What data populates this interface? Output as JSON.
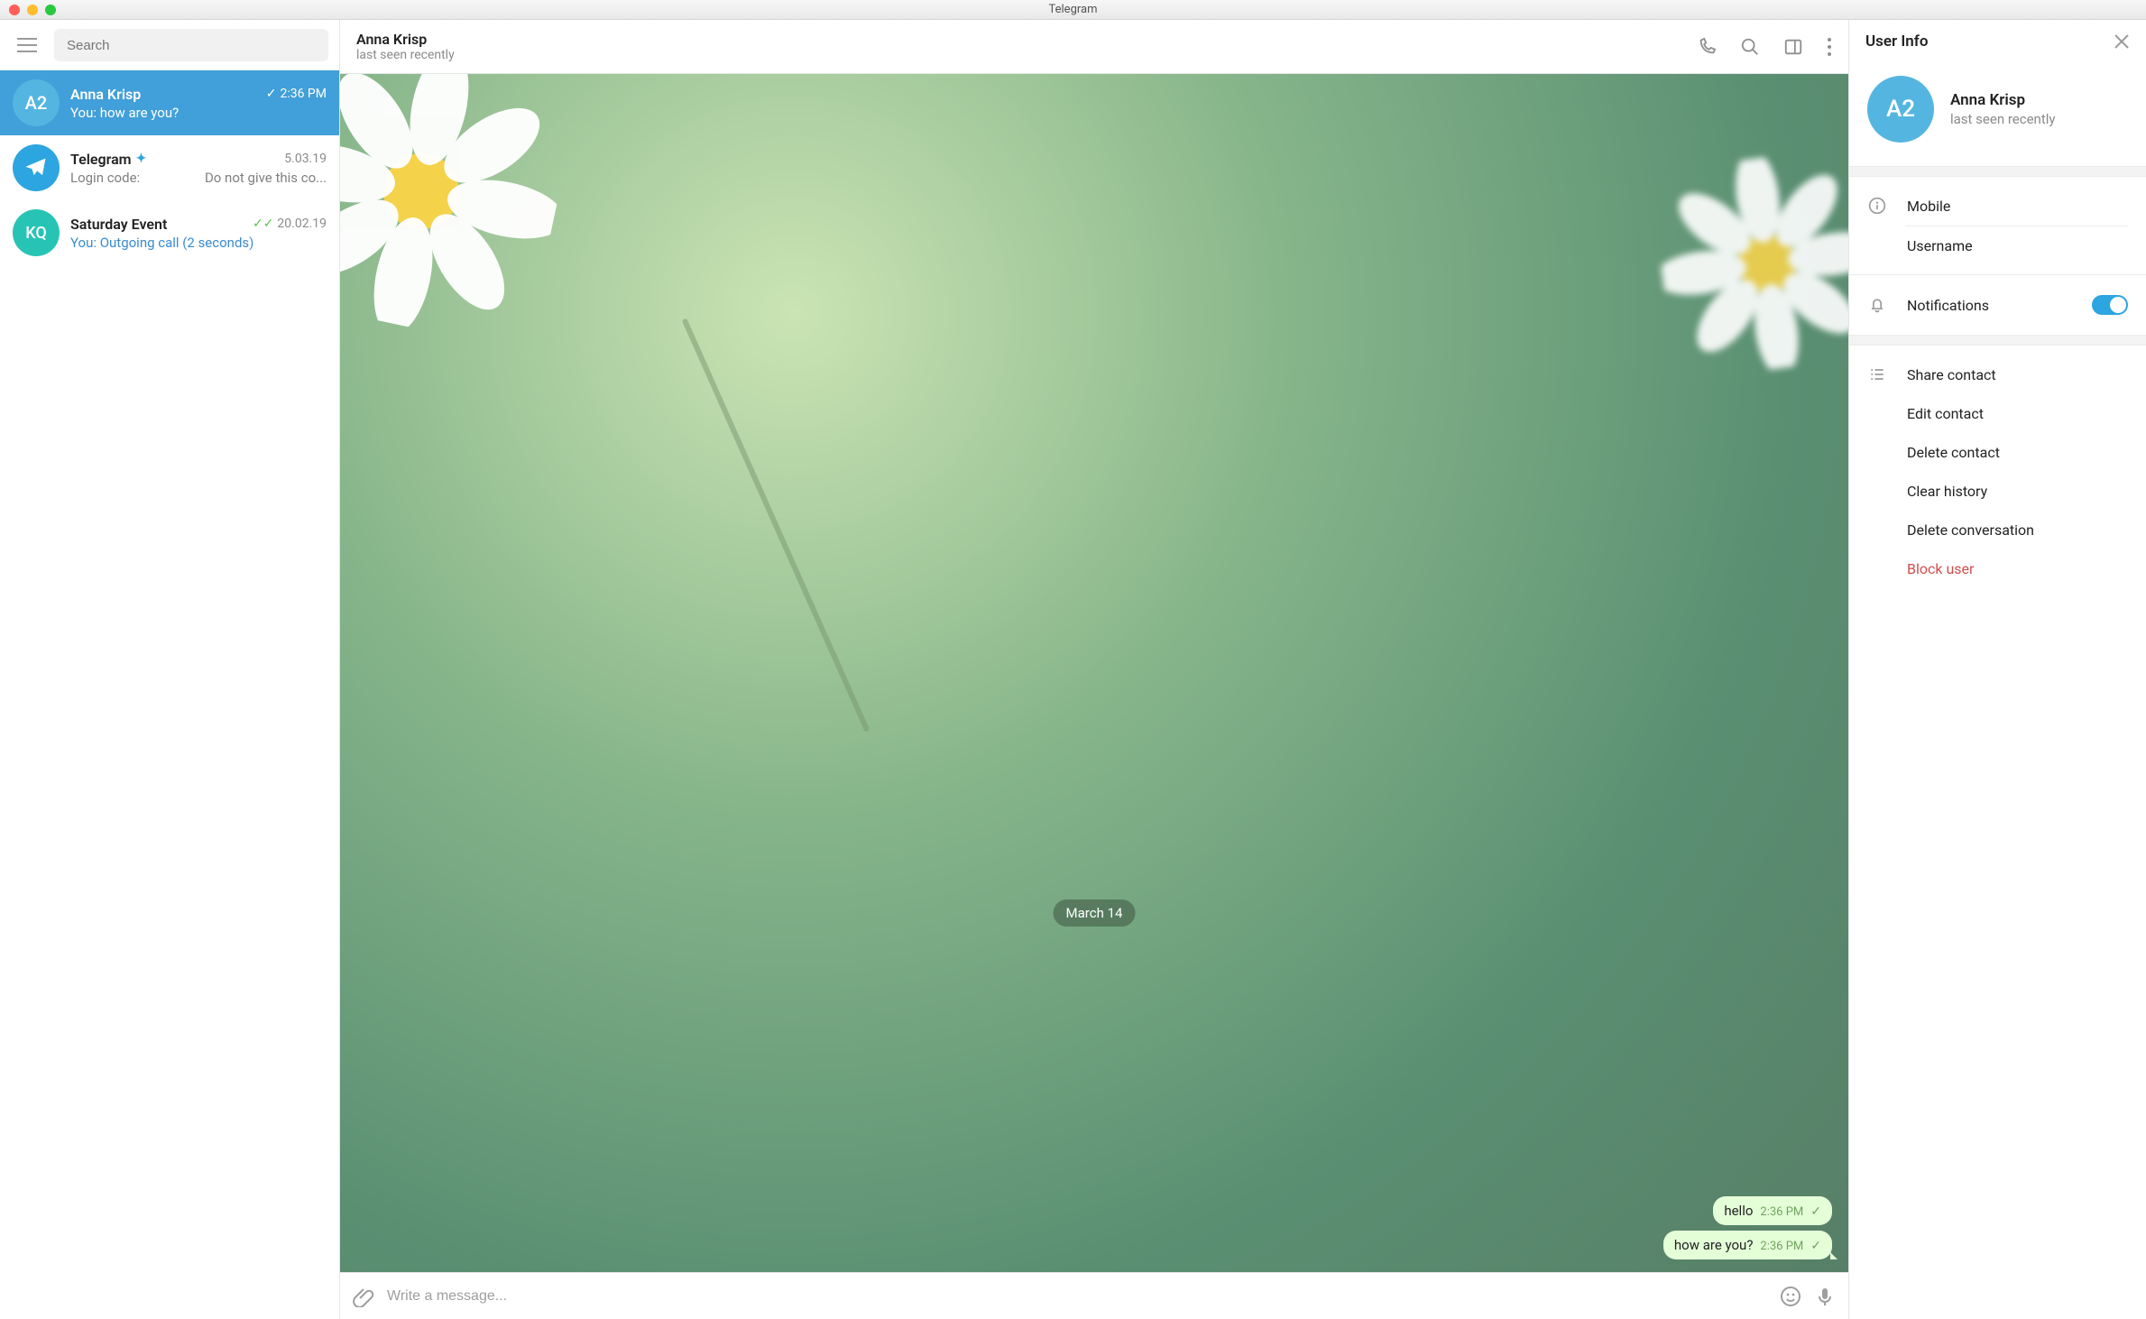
{
  "window": {
    "title": "Telegram"
  },
  "sidebar": {
    "search_placeholder": "Search",
    "chats": [
      {
        "name": "Anna Krisp",
        "initials": "A2",
        "time": "2:36 PM",
        "preview": "You: how are you?",
        "selected": true,
        "read": true
      },
      {
        "name": "Telegram",
        "verified": true,
        "time": "5.03.19",
        "preview": "Login code:",
        "extra": "Do not give this co..."
      },
      {
        "name": "Saturday Event",
        "initials": "KQ",
        "time": "20.02.19",
        "preview": "You: Outgoing call (2 seconds)",
        "link": true,
        "delivered": true
      }
    ]
  },
  "chat": {
    "contact_name": "Anna Krisp",
    "contact_status": "last seen recently",
    "date_label": "March 14",
    "messages": [
      {
        "text": "hello",
        "time": "2:36 PM"
      },
      {
        "text": "how are you?",
        "time": "2:36 PM"
      }
    ],
    "compose_placeholder": "Write a message..."
  },
  "panel": {
    "title": "User Info",
    "name": "Anna Krisp",
    "initials": "A2",
    "status": "last seen recently",
    "info": {
      "mobile_label": "Mobile",
      "username_label": "Username"
    },
    "notifications_label": "Notifications",
    "actions": {
      "share": "Share contact",
      "edit": "Edit contact",
      "delete_contact": "Delete contact",
      "clear": "Clear history",
      "delete_conv": "Delete conversation",
      "block": "Block user"
    }
  }
}
